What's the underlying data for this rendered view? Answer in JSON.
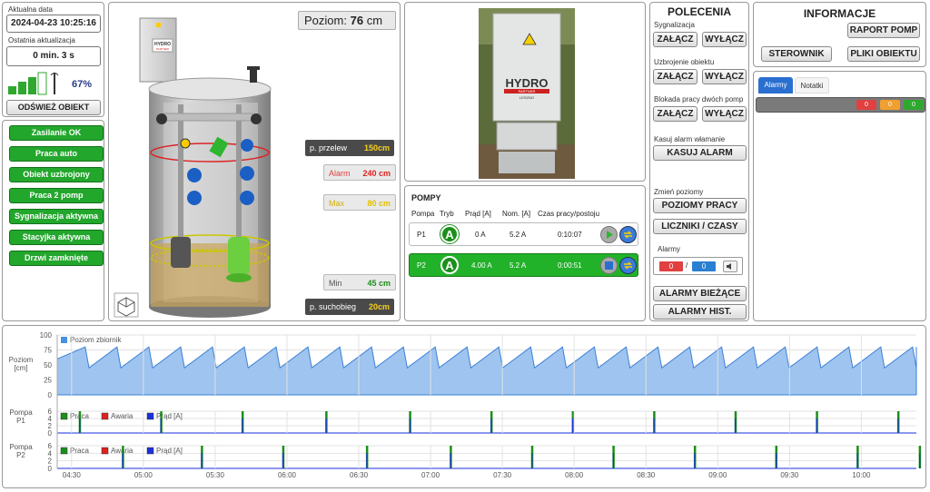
{
  "status": {
    "date_label": "Aktualna data",
    "date_value": "2024-04-23 10:25:16",
    "update_label": "Ostatnia aktualizacja",
    "update_value": "0 min. 3 s",
    "signal_percent": "67%",
    "refresh_label": "ODŚWIEŻ OBIEKT"
  },
  "states": [
    "Zasilanie OK",
    "Praca auto",
    "Obiekt uzbrojony",
    "Praca 2 pomp",
    "Sygnalizacja aktywna",
    "Stacyjka aktywna",
    "Drzwi zamknięte"
  ],
  "tank": {
    "level_label": "Poziom:",
    "level_value": "76",
    "level_unit": "cm",
    "przelew_label": "p. przelew",
    "przelew_value": "150cm",
    "alarm_label": "Alarm",
    "alarm_value": "240 cm",
    "max_label": "Max",
    "max_value": "80 cm",
    "min_label": "Min",
    "min_value": "45 cm",
    "suchobieg_label": "p. suchobieg",
    "suchobieg_value": "20cm"
  },
  "photo": {
    "brand": "HYDRO",
    "brand_sub": "PARTNER",
    "brand_city": "LESZNO"
  },
  "pumps": {
    "title": "POMPY",
    "headers": [
      "Pompa",
      "Tryb",
      "Prąd [A]",
      "Nom. [A]",
      "Czas pracy/postoju"
    ],
    "rows": [
      {
        "name": "P1",
        "mode": "A",
        "current": "0 A",
        "nom": "5.2 A",
        "time": "0:10:07"
      },
      {
        "name": "P2",
        "mode": "A",
        "current": "4.00 A",
        "nom": "5.2 A",
        "time": "0:00:51"
      }
    ]
  },
  "commands": {
    "title": "POLECENIA",
    "sig_label": "Sygnalizacja",
    "arm_label": "Uzbrojenie obiektu",
    "block_label": "Blokada pracy dwóch pomp",
    "on": "ZAŁĄCZ",
    "off": "WYŁĄCZ",
    "alarm_reset_label": "Kasuj alarm włamanie",
    "alarm_reset_btn": "KASUJ ALARM",
    "levels_label": "Zmień poziomy",
    "levels_btn": "POZIOMY PRACY",
    "counters_btn": "LICZNIKI / CZASY",
    "alarms_label": "Alarmy",
    "alarm_count_a": "0",
    "alarm_sep": "/",
    "alarm_count_b": "0",
    "current_alarms_btn": "ALARMY BIEŻĄCE",
    "hist_alarms_btn": "ALARMY HIST."
  },
  "info": {
    "title": "INFORMACJE",
    "report_btn": "RAPORT POMP",
    "control_btn": "STEROWNIK",
    "files_btn": "PLIKI OBIEKTU",
    "tabs": [
      "Alarmy",
      "Notatki"
    ],
    "counts": [
      "0",
      "0",
      "0"
    ]
  },
  "chart_data": [
    {
      "type": "area",
      "ylabel": "Poziom\n[cm]",
      "ylim": [
        0,
        100
      ],
      "yticks": [
        "100",
        "75",
        "50",
        "25",
        "0"
      ],
      "series": [
        {
          "name": "Poziom zbiornik",
          "sawtooth_min": 45,
          "sawtooth_max": 80
        }
      ],
      "cycles": 27,
      "legend_color": "#4a90e2"
    },
    {
      "type": "bar",
      "ylabel": "Pompa\nP1",
      "ylim": [
        0,
        6
      ],
      "yticks": [
        "6",
        "4",
        "2",
        "0"
      ],
      "series": [
        {
          "name": "Praca",
          "color": "#1a8f1a"
        },
        {
          "name": "Awaria",
          "color": "#e02020"
        },
        {
          "name": "Prąd [A]",
          "color": "#1a2fe0"
        }
      ],
      "pulses": [
        "04:33",
        "05:07",
        "05:41",
        "06:16",
        "06:51",
        "07:25",
        "07:59",
        "08:33",
        "09:07",
        "09:41",
        "10:15"
      ]
    },
    {
      "type": "bar",
      "ylabel": "Pompa\nP2",
      "ylim": [
        0,
        6
      ],
      "yticks": [
        "6",
        "4",
        "2",
        "0"
      ],
      "series": [
        {
          "name": "Praca",
          "color": "#1a8f1a"
        },
        {
          "name": "Awaria",
          "color": "#e02020"
        },
        {
          "name": "Prąd [A]",
          "color": "#1a2fe0"
        }
      ],
      "pulses": [
        "04:51",
        "05:24",
        "05:58",
        "06:33",
        "07:08",
        "07:42",
        "08:16",
        "08:50",
        "09:24",
        "09:58",
        "10:24"
      ]
    }
  ],
  "time_axis": [
    "04:30",
    "05:00",
    "05:30",
    "06:00",
    "06:30",
    "07:00",
    "07:30",
    "08:00",
    "08:30",
    "09:00",
    "09:30",
    "10:00"
  ]
}
